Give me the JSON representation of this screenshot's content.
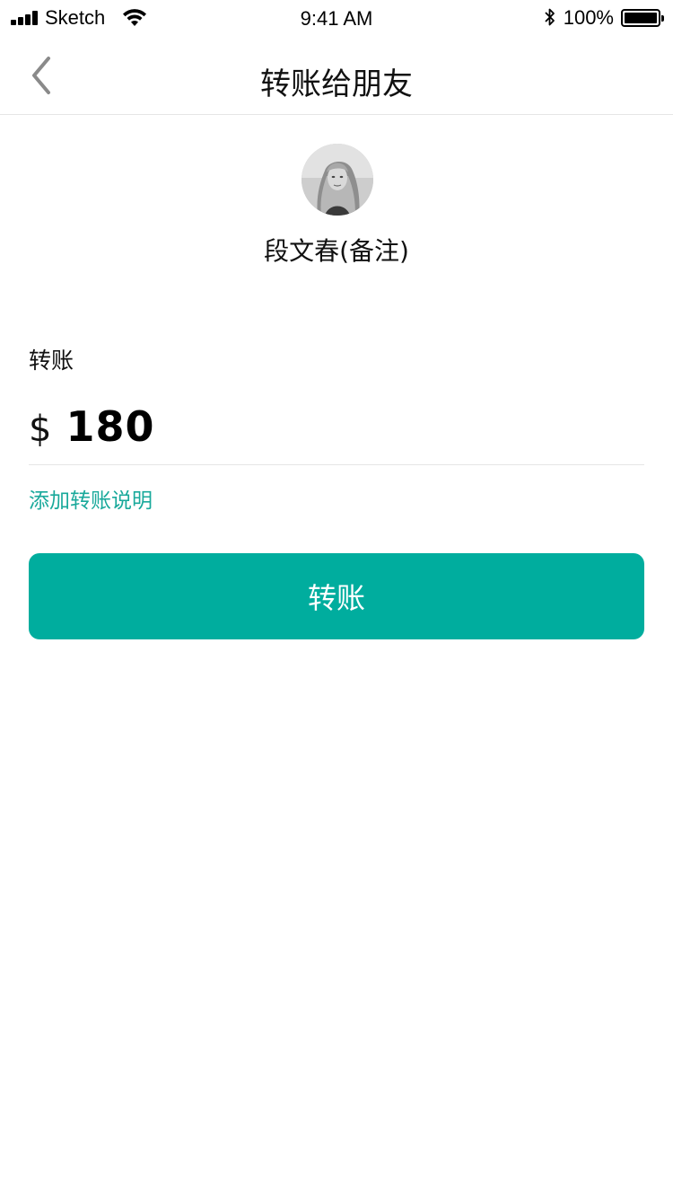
{
  "status_bar": {
    "carrier": "Sketch",
    "time": "9:41 AM",
    "battery": "100%",
    "icons": [
      "signal-icon",
      "wifi-icon",
      "bluetooth-icon",
      "battery-icon"
    ]
  },
  "nav": {
    "title": "转账给朋友",
    "back_icon": "chevron-left-icon"
  },
  "recipient": {
    "name": "段文春(备注)"
  },
  "transfer": {
    "label": "转账",
    "currency": "$",
    "amount": "180",
    "add_note": "添加转账说明",
    "button_label": "转账"
  },
  "colors": {
    "accent": "#00ad9e",
    "link": "#19a99b",
    "divider": "#e6e6e6"
  }
}
